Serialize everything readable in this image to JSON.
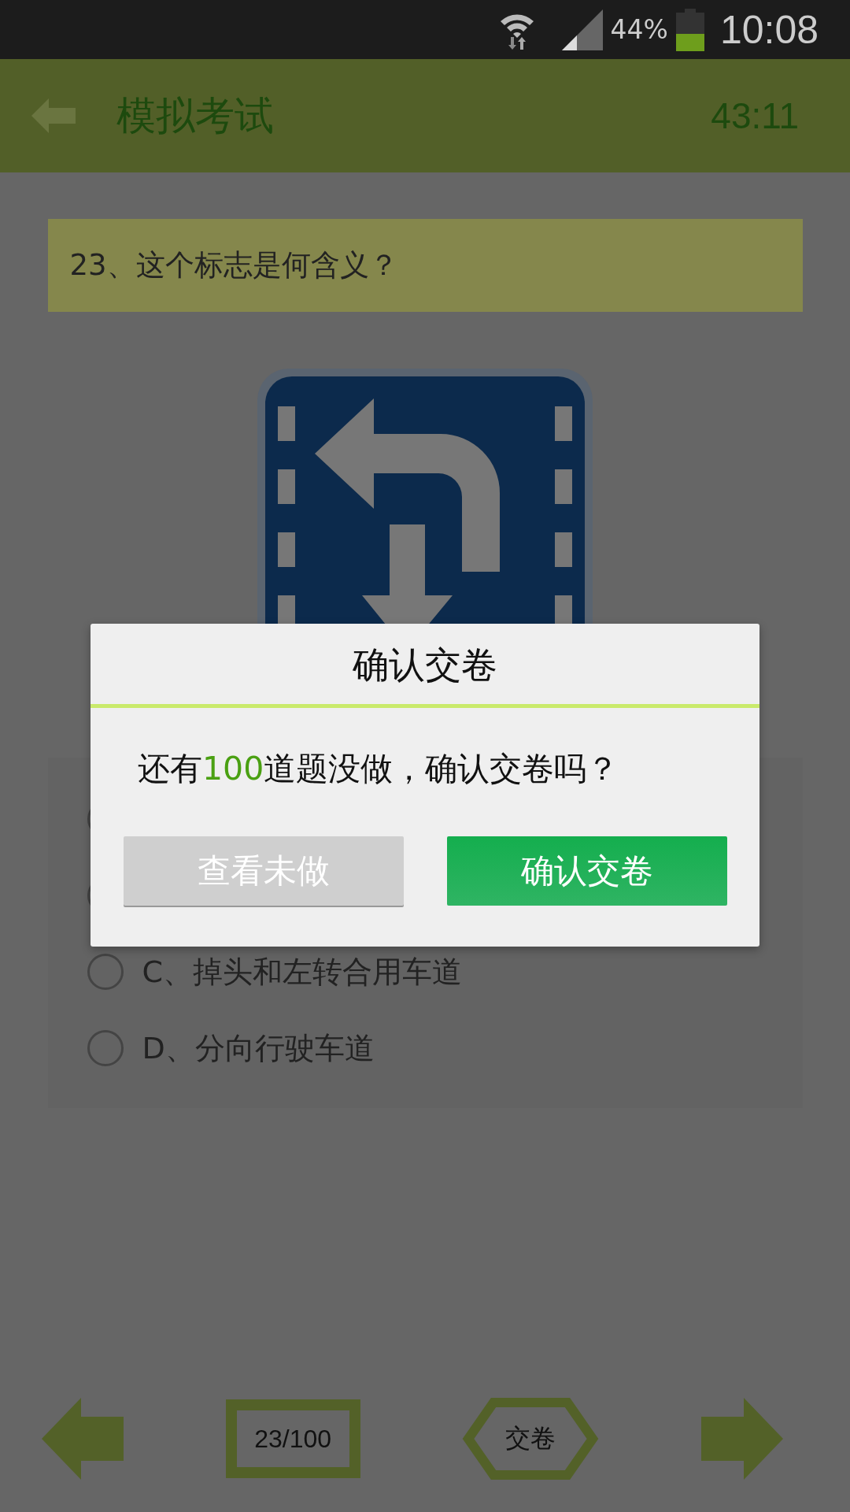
{
  "status_bar": {
    "battery_text": "44%",
    "time": "10:08"
  },
  "header": {
    "title": "模拟考试",
    "timer": "43:11"
  },
  "question": {
    "text": "23、这个标志是何含义？"
  },
  "options": [
    {
      "selected": false
    },
    {
      "selected": false
    },
    {
      "text": "C、掉头和左转合用车道",
      "selected": false
    },
    {
      "text": "D、分向行驶车道",
      "selected": false
    }
  ],
  "dialog": {
    "title": "确认交卷",
    "message_before": "还有",
    "count": "100",
    "message_after": "道题没做，确认交卷吗？",
    "buttons": [
      {
        "label": "查看未做",
        "kind": "secondary"
      },
      {
        "label": "确认交卷",
        "kind": "primary"
      }
    ]
  },
  "bottom_nav": {
    "counter": "23/100",
    "submit": "交卷"
  }
}
